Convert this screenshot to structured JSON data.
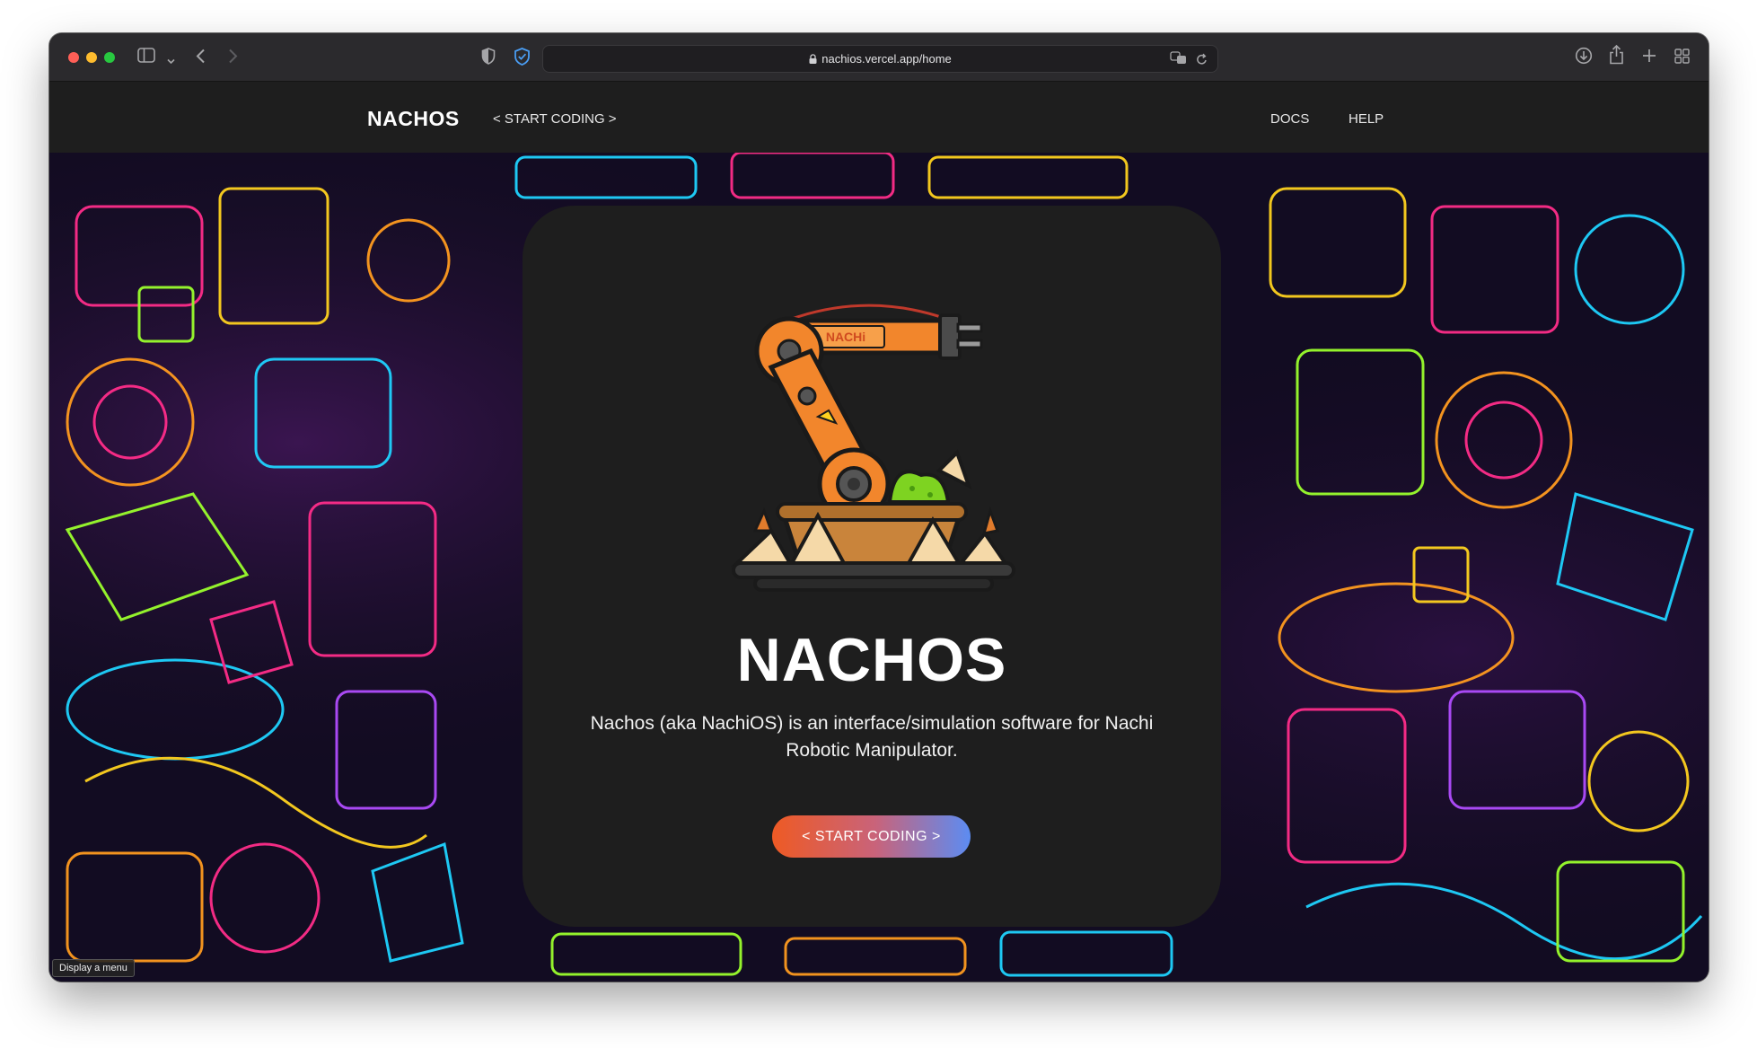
{
  "browser": {
    "url": "nachios.vercel.app/home"
  },
  "navbar": {
    "brand": "NACHOS",
    "start_coding_link": "< START CODING >",
    "docs_link": "DOCS",
    "help_link": "HELP"
  },
  "hero": {
    "title": "NACHOS",
    "description": "Nachos (aka NachiOS) is an interface/simulation software for Nachi Robotic Manipulator.",
    "cta_label": "< START CODING >",
    "robot_arm_label": "NACHi"
  },
  "tooltip": "Display a menu",
  "colors": {
    "navbar_bg": "#1e1e1e",
    "card_bg": "#1e1e1e",
    "cta_gradient_start": "#ee5a24",
    "cta_gradient_end": "#5c8cf2",
    "robot_orange": "#f2862c"
  },
  "icons": [
    "sidebar-icon",
    "back-icon",
    "forward-icon",
    "shield-icon",
    "privacy-shield-icon",
    "lock-icon",
    "translate-icon",
    "reload-icon",
    "download-icon",
    "share-icon",
    "new-tab-icon",
    "tab-overview-icon"
  ]
}
